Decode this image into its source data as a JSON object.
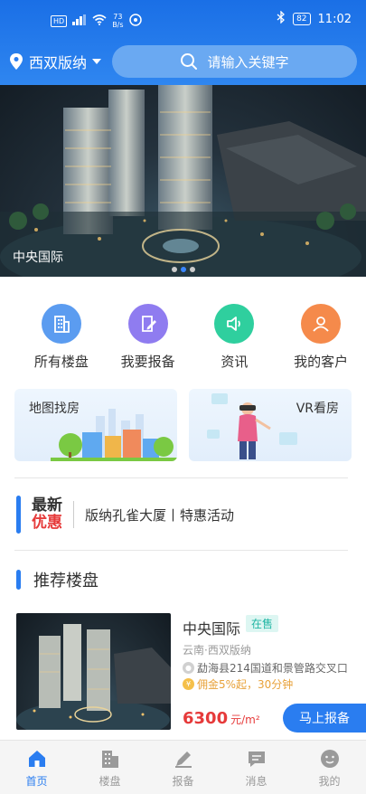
{
  "status_bar": {
    "hd_label": "HD",
    "signal_label": "4G",
    "speed_value": "73",
    "speed_unit": "B/s",
    "battery": "82",
    "time": "11:02"
  },
  "header": {
    "city": "西双版纳",
    "search_placeholder": "请输入关键字"
  },
  "banner": {
    "title": "中央国际",
    "slide_count": 3,
    "active_slide": 1
  },
  "quick_menu": [
    {
      "label": "所有楼盘",
      "icon": "building-icon",
      "color": "#5b9cf0"
    },
    {
      "label": "我要报备",
      "icon": "edit-document-icon",
      "color": "#8f7cf0"
    },
    {
      "label": "资讯",
      "icon": "speaker-icon",
      "color": "#2fcf9e"
    },
    {
      "label": "我的客户",
      "icon": "customers-icon",
      "color": "#f58a4b"
    }
  ],
  "feature_cards": {
    "map": {
      "label": "地图找房"
    },
    "vr": {
      "label": "VR看房"
    }
  },
  "promo": {
    "tag_line1": "最新",
    "tag_line2": "优惠",
    "text": "版纳孔雀大厦丨特惠活动"
  },
  "section": {
    "title": "推荐楼盘"
  },
  "listing": {
    "name": "中央国际",
    "status": "在售",
    "area": "云南·西双版纳",
    "address": "勐海县214国道和景管路交叉口",
    "commission": "佣金5%起，30分钟",
    "price": "6300",
    "price_unit": "元/m²",
    "report_button": "马上报备"
  },
  "tabbar": [
    {
      "label": "首页",
      "icon": "home-icon",
      "active": true
    },
    {
      "label": "楼盘",
      "icon": "buildings-icon",
      "active": false
    },
    {
      "label": "报备",
      "icon": "pen-icon",
      "active": false
    },
    {
      "label": "消息",
      "icon": "message-icon",
      "active": false
    },
    {
      "label": "我的",
      "icon": "profile-icon",
      "active": false
    }
  ],
  "colors": {
    "primary": "#2a7df0",
    "price_red": "#e63a3a",
    "badge_green": "#22b6a4"
  }
}
